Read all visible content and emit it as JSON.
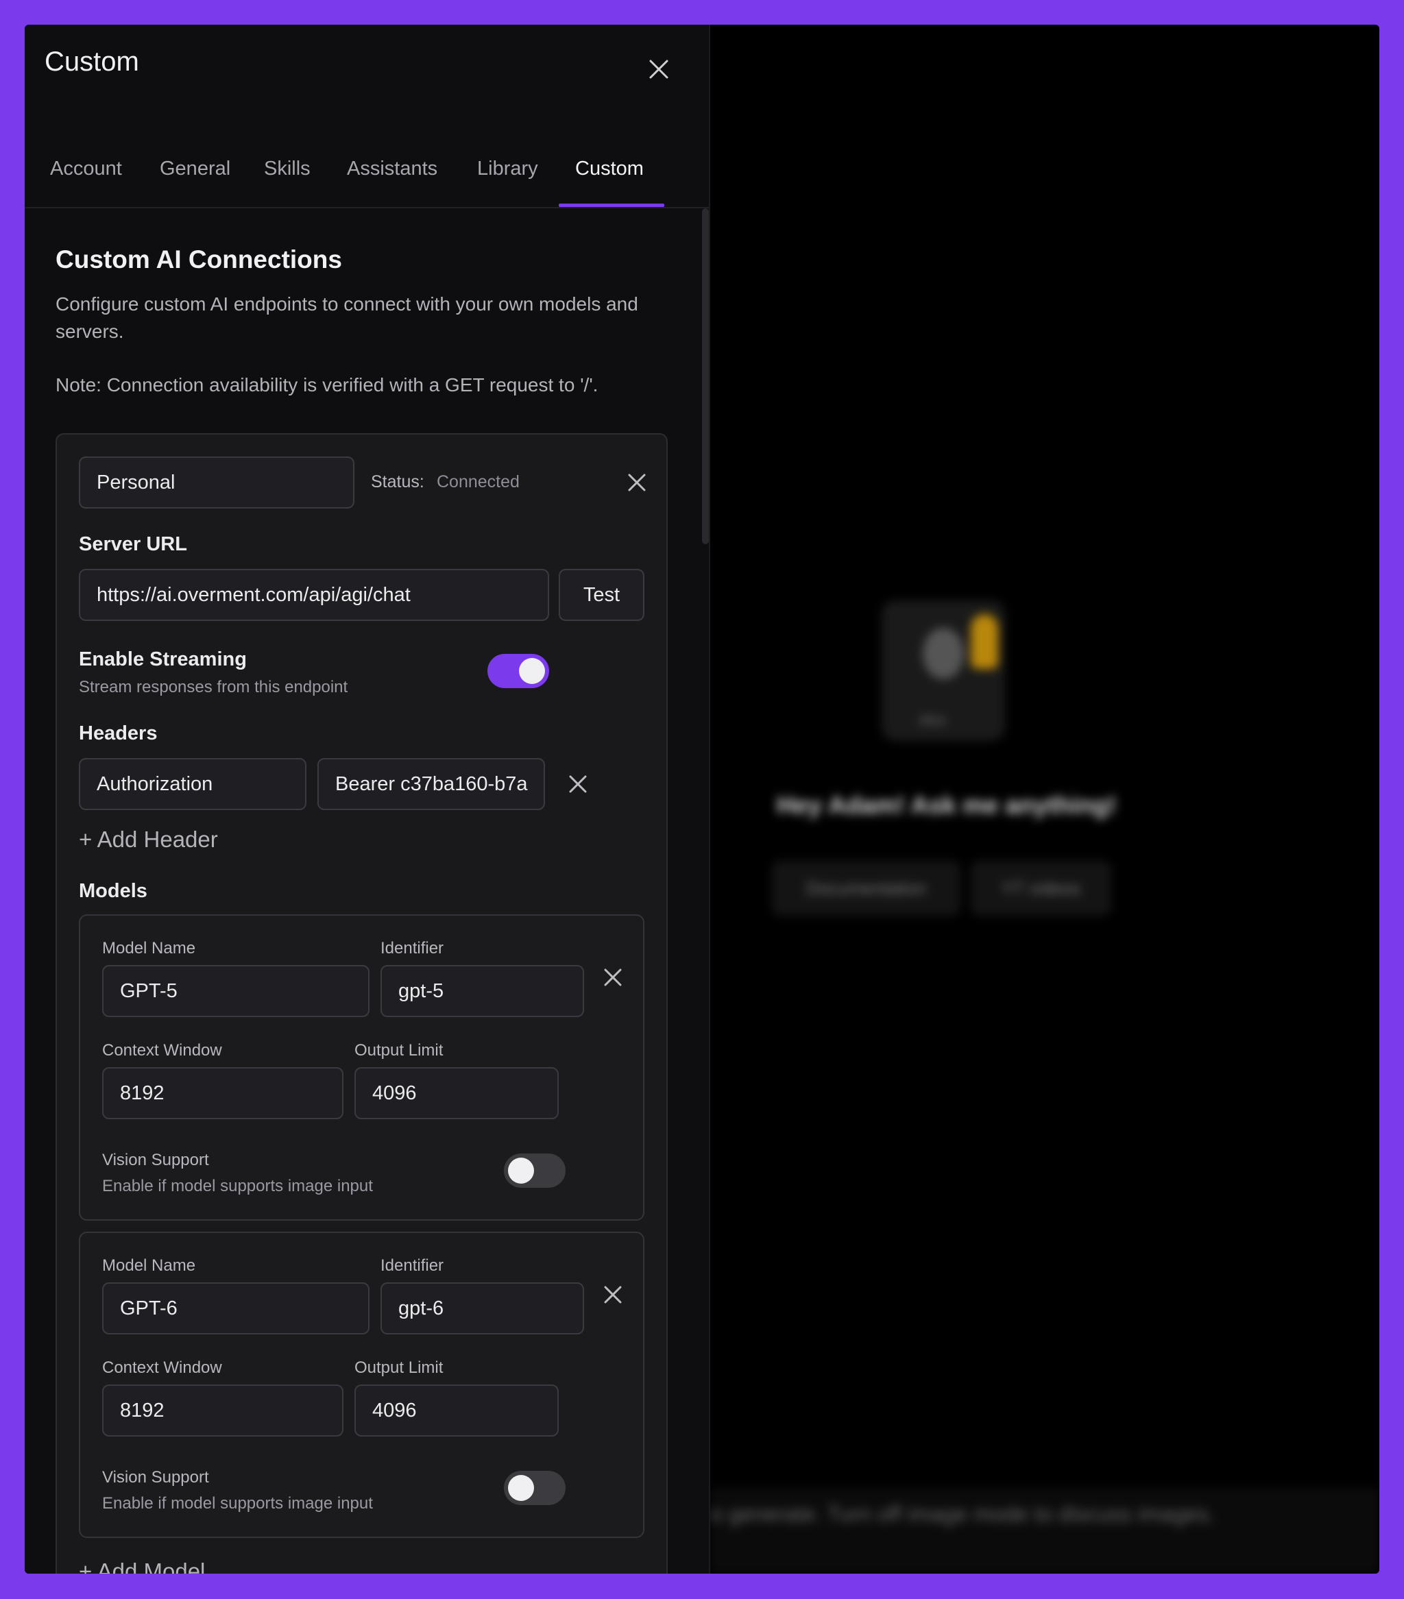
{
  "panel": {
    "title": "Custom",
    "tabs": [
      {
        "label": "Account"
      },
      {
        "label": "General"
      },
      {
        "label": "Skills"
      },
      {
        "label": "Assistants"
      },
      {
        "label": "Library"
      },
      {
        "label": "Custom"
      }
    ],
    "active_tab": "Custom"
  },
  "section": {
    "title": "Custom AI Connections",
    "description": "Configure custom AI endpoints to connect with your own models and servers.",
    "note": "Note: Connection availability is verified with a GET request to '/'."
  },
  "connection": {
    "name": "Personal",
    "status_label": "Status:",
    "status_value": "Connected",
    "server_url_label": "Server URL",
    "server_url": "https://ai.overment.com/api/agi/chat",
    "test_label": "Test",
    "streaming_label": "Enable Streaming",
    "streaming_desc": "Stream responses from this endpoint",
    "streaming_enabled": true,
    "headers_label": "Headers",
    "headers": [
      {
        "key": "Authorization",
        "value": "Bearer c37ba160-b7a"
      }
    ],
    "add_header_label": "+ Add Header",
    "models_label": "Models",
    "models": [
      {
        "name_label": "Model Name",
        "name": "GPT-5",
        "id_label": "Identifier",
        "id": "gpt-5",
        "context_label": "Context Window",
        "context": "8192",
        "output_label": "Output Limit",
        "output": "4096",
        "vision_label": "Vision Support",
        "vision_desc": "Enable if model supports image input",
        "vision_enabled": false
      },
      {
        "name_label": "Model Name",
        "name": "GPT-6",
        "id_label": "Identifier",
        "id": "gpt-6",
        "context_label": "Context Window",
        "context": "8192",
        "output_label": "Output Limit",
        "output": "4096",
        "vision_label": "Vision Support",
        "vision_desc": "Enable if model supports image input",
        "vision_enabled": false
      }
    ],
    "add_model_label": "+ Add Model"
  },
  "background": {
    "avatar_name": "Alice",
    "greeting": "Hey Adam! Ask me anything!",
    "chips": [
      {
        "label": "Documentation"
      },
      {
        "label": "YT videos"
      }
    ],
    "bottom_text": "o generate. Turn off image mode to discuss images."
  },
  "colors": {
    "accent": "#7c3aed",
    "panel_bg": "#0e0e10",
    "card_bg": "#19191c"
  }
}
